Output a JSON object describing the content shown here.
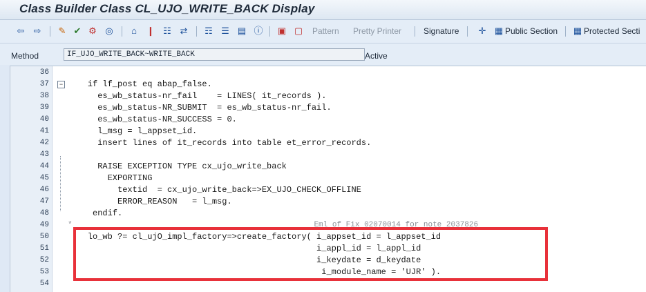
{
  "window": {
    "title": "Class Builder Class CL_UJO_WRITE_BACK Display"
  },
  "toolbar": {
    "pattern_label": "Pattern",
    "pretty_printer_label": "Pretty Printer",
    "signature_label": "Signature",
    "public_section_label": "Public Section",
    "protected_section_label": "Protected Secti"
  },
  "method": {
    "label": "Method",
    "value": "IF_UJO_WRITE_BACK~WRITE_BACK",
    "status": "Active"
  },
  "code_lines": [
    {
      "n": "36",
      "t": ""
    },
    {
      "n": "37",
      "t": "    if lf_post eq abap_false."
    },
    {
      "n": "38",
      "t": "      es_wb_status-nr_fail    = LINES( it_records )."
    },
    {
      "n": "39",
      "t": "      es_wb_status-NR_SUBMIT  = es_wb_status-nr_fail."
    },
    {
      "n": "40",
      "t": "      es_wb_status-NR_SUCCESS = 0."
    },
    {
      "n": "41",
      "t": "      l_msg = l_appset_id."
    },
    {
      "n": "42",
      "t": "      insert lines of it_records into table et_error_records."
    },
    {
      "n": "43",
      "t": ""
    },
    {
      "n": "44",
      "t": "      RAISE EXCEPTION TYPE cx_ujo_write_back"
    },
    {
      "n": "45",
      "t": "        EXPORTING"
    },
    {
      "n": "46",
      "t": "          textid  = cx_ujo_write_back=>EX_UJO_CHECK_OFFLINE"
    },
    {
      "n": "47",
      "t": "          ERROR_REASON   = l_msg."
    },
    {
      "n": "48",
      "t": "     endif."
    },
    {
      "n": "49",
      "t": ""
    },
    {
      "n": "50",
      "t": "    lo_wb ?= cl_ujO_impl_factory=>create_factory( i_appset_id = l_appset_id"
    },
    {
      "n": "51",
      "t": "                                                  i_appl_id = l_appl_id"
    },
    {
      "n": "52",
      "t": "                                                  i_keydate = d_keydate"
    },
    {
      "n": "53",
      "t": "                                                   i_module_name = 'UJR' )."
    },
    {
      "n": "54",
      "t": ""
    }
  ],
  "comment_49": "*                                                     Eml of Fix 02070014 for note 2037826",
  "colors": {
    "highlight_border": "#e8313a",
    "background": "#dfe9f5"
  }
}
